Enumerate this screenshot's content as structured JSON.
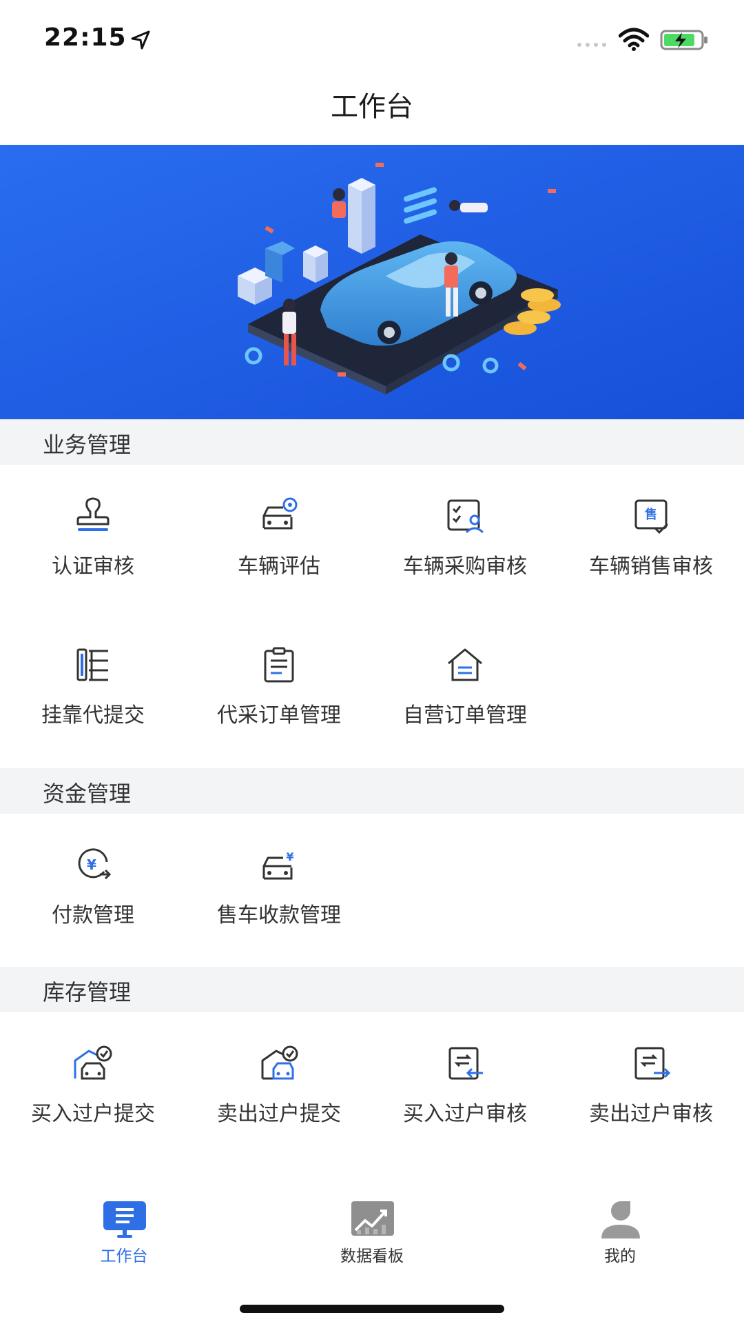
{
  "status_bar": {
    "time": "22:15"
  },
  "nav": {
    "title": "工作台"
  },
  "sections": [
    {
      "title": "业务管理",
      "items": [
        {
          "label": "认证审核",
          "icon": "stamp-icon"
        },
        {
          "label": "车辆评估",
          "icon": "car-evaluate-icon"
        },
        {
          "label": "车辆采购审核",
          "icon": "purchase-review-icon"
        },
        {
          "label": "车辆销售审核",
          "icon": "sales-review-icon"
        },
        {
          "label": "挂靠代提交",
          "icon": "affiliate-submit-icon"
        },
        {
          "label": "代采订单管理",
          "icon": "proxy-order-icon"
        },
        {
          "label": "自营订单管理",
          "icon": "self-order-icon"
        }
      ]
    },
    {
      "title": "资金管理",
      "items": [
        {
          "label": "付款管理",
          "icon": "payment-icon"
        },
        {
          "label": "售车收款管理",
          "icon": "car-collection-icon"
        }
      ]
    },
    {
      "title": "库存管理",
      "items": [
        {
          "label": "买入过户提交",
          "icon": "buy-transfer-submit-icon"
        },
        {
          "label": "卖出过户提交",
          "icon": "sell-transfer-submit-icon"
        },
        {
          "label": "买入过户审核",
          "icon": "buy-transfer-review-icon"
        },
        {
          "label": "卖出过户审核",
          "icon": "sell-transfer-review-icon"
        }
      ]
    }
  ],
  "tabs": [
    {
      "label": "工作台",
      "icon": "workbench-icon",
      "active": true
    },
    {
      "label": "数据看板",
      "icon": "data-board-icon",
      "active": false
    },
    {
      "label": "我的",
      "icon": "profile-icon",
      "active": false
    }
  ],
  "colors": {
    "accent": "#2f6fe6",
    "banner": "#1f5fe8",
    "inactive": "#333333"
  }
}
